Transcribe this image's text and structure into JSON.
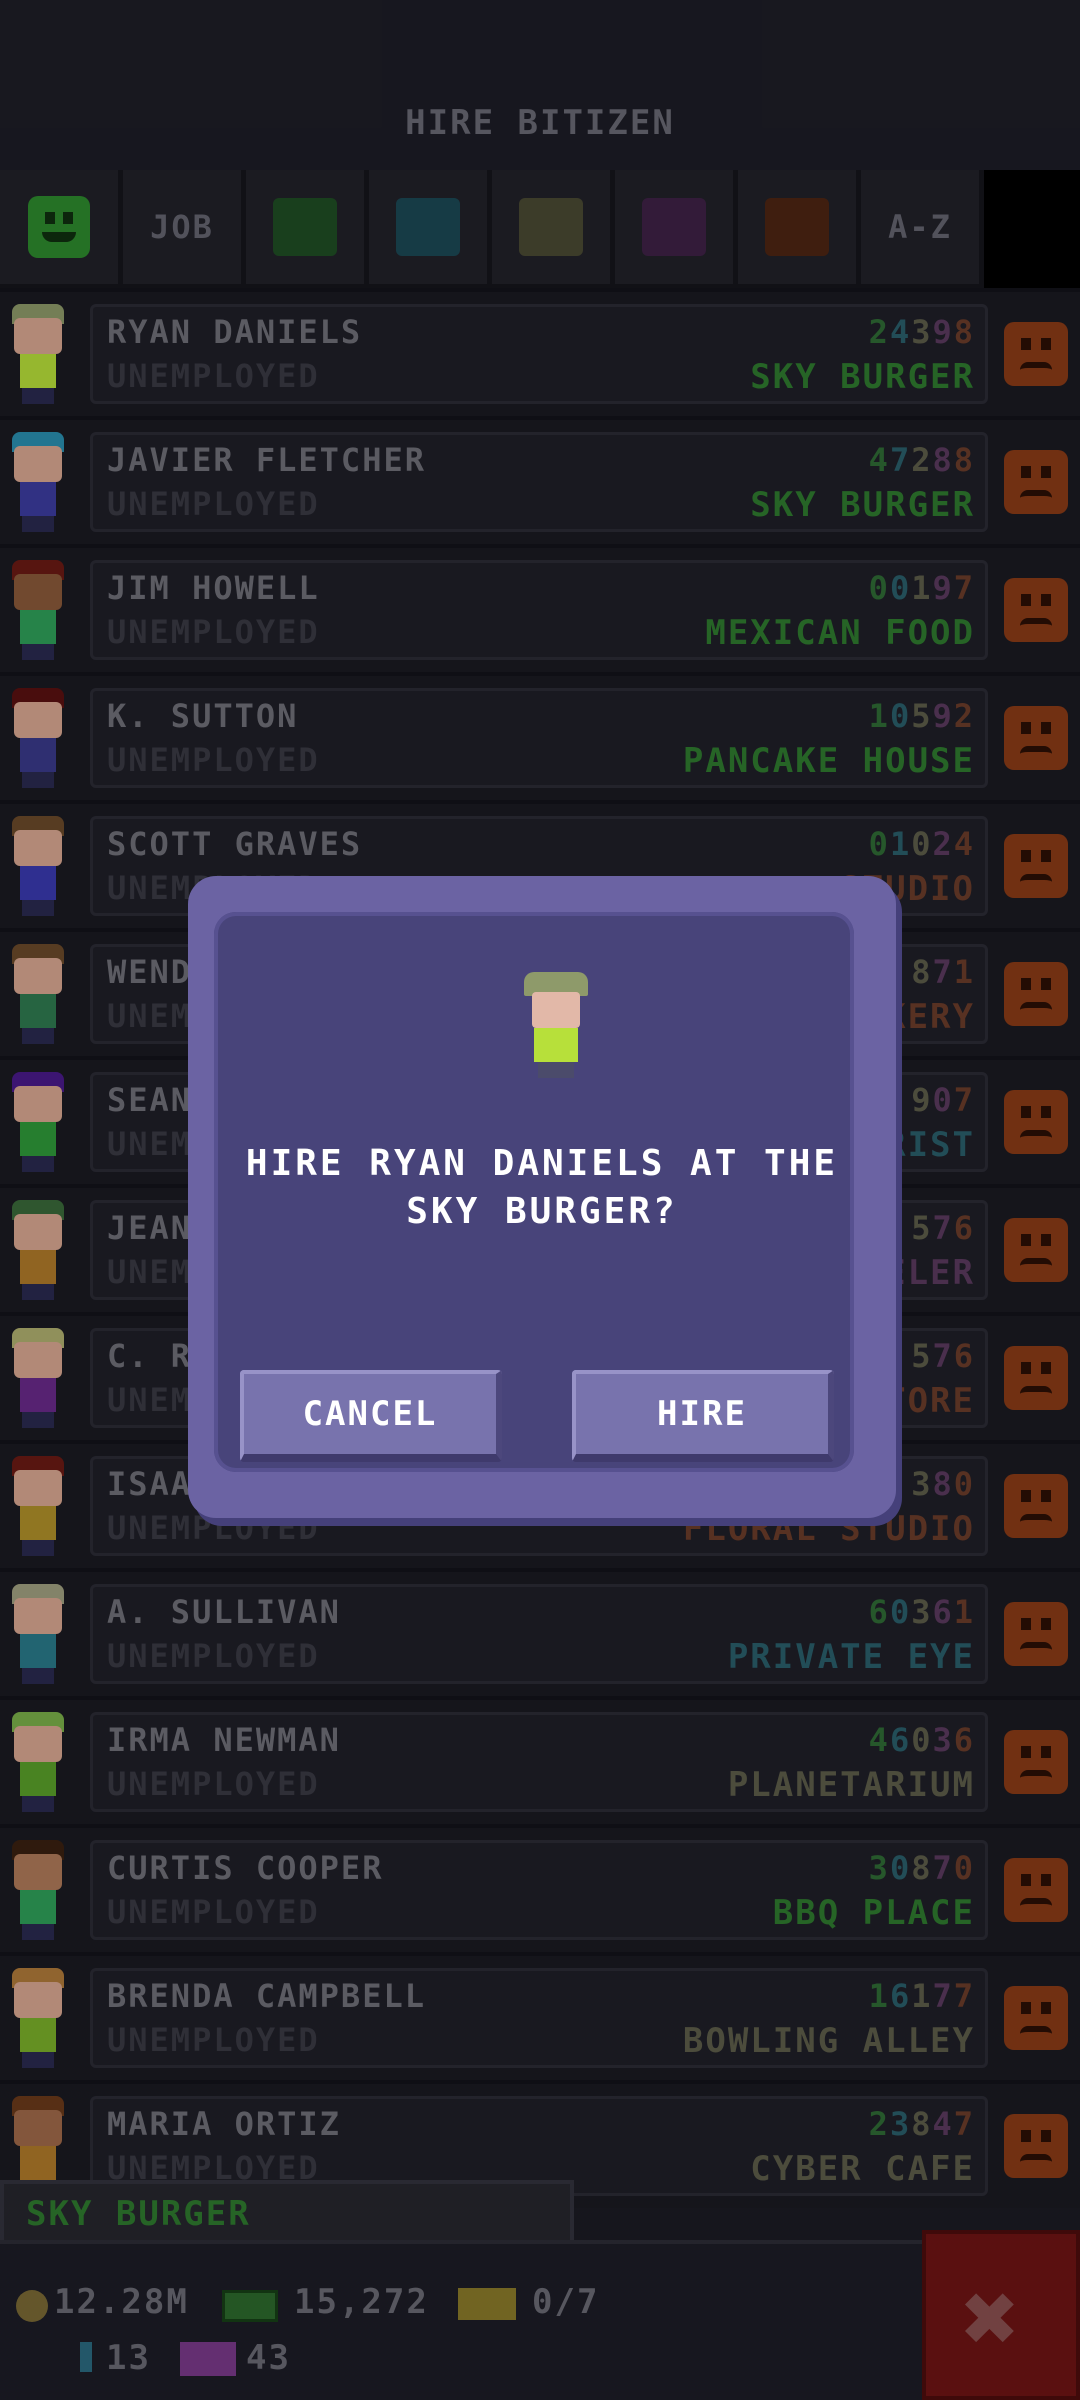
{
  "header": {
    "title": "HIRE BITIZEN"
  },
  "filters": [
    {
      "type": "smiley",
      "name": "happiness-filter"
    },
    {
      "type": "text",
      "label": "JOB"
    },
    {
      "type": "swatch",
      "color": "#1f4d24"
    },
    {
      "type": "swatch",
      "color": "#1c4855"
    },
    {
      "type": "swatch",
      "color": "#4a4a33"
    },
    {
      "type": "swatch",
      "color": "#3f2146"
    },
    {
      "type": "swatch",
      "color": "#4d2513"
    },
    {
      "type": "text",
      "label": "A-Z"
    }
  ],
  "bitizens": [
    {
      "name": "RYAN DANIELS",
      "status": "UNEMPLOYED",
      "stats": [
        "2",
        "4",
        "3",
        "9",
        "8"
      ],
      "dream_job": "SKY BURGER",
      "job_color": "#2f7a2f",
      "hair": "#8e9a6a",
      "skin": "#d9a892",
      "shirt": "#b7e03a"
    },
    {
      "name": "JAVIER FLETCHER",
      "status": "UNEMPLOYED",
      "stats": [
        "4",
        "7",
        "2",
        "8",
        "8"
      ],
      "dream_job": "SKY BURGER",
      "job_color": "#2f7a2f",
      "hair": "#2a8fb0",
      "skin": "#d9a892",
      "shirt": "#3c3ca0"
    },
    {
      "name": "JIM HOWELL",
      "status": "UNEMPLOYED",
      "stats": [
        "0",
        "0",
        "1",
        "9",
        "7"
      ],
      "dream_job": "MEXICAN FOOD",
      "job_color": "#2f7a2f",
      "hair": "#6b1a14",
      "skin": "#8a5a3a",
      "shirt": "#2fa05a"
    },
    {
      "name": "K. SUTTON",
      "status": "UNEMPLOYED",
      "stats": [
        "1",
        "0",
        "5",
        "9",
        "2"
      ],
      "dream_job": "PANCAKE HOUSE",
      "job_color": "#2f7a2f",
      "hair": "#5a1010",
      "skin": "#d9a892",
      "shirt": "#3a3a8a"
    },
    {
      "name": "SCOTT GRAVES",
      "status": "UNEMPLOYED",
      "stats": [
        "0",
        "1",
        "0",
        "2",
        "4"
      ],
      "dream_job": "STUDIO",
      "job_color": "#6b3c2a",
      "hair": "#6b4a2a",
      "skin": "#d9a892",
      "shirt": "#3a3ab0"
    },
    {
      "name": "WENDY",
      "status": "UNEMPLOYED",
      "stats": [
        "",
        "",
        "8",
        "7",
        "1"
      ],
      "dream_job": "BAKERY",
      "job_color": "#6b3c2a",
      "hair": "#6b4a2a",
      "skin": "#d9a892",
      "shirt": "#2f7a50"
    },
    {
      "name": "SEAN",
      "status": "UNEMPLOYED",
      "stats": [
        "",
        "",
        "9",
        "0",
        "7"
      ],
      "dream_job": "FLORIST",
      "job_color": "#2a5f6b",
      "hair": "#4a1a8a",
      "skin": "#d9a892",
      "shirt": "#2f9a3a"
    },
    {
      "name": "JEAN",
      "status": "UNEMPLOYED",
      "stats": [
        "",
        "",
        "5",
        "7",
        "6"
      ],
      "dream_job": "JEWELER",
      "job_color": "#5b3a5e",
      "hair": "#3a6a3a",
      "skin": "#d9a892",
      "shirt": "#b07a2a"
    },
    {
      "name": "C. R",
      "status": "UNEMPLOYED",
      "stats": [
        "",
        "",
        "5",
        "7",
        "6"
      ],
      "dream_job": "STORE",
      "job_color": "#6b3c2a",
      "hair": "#b0b070",
      "skin": "#d9a892",
      "shirt": "#6a2a8a"
    },
    {
      "name": "ISAAC",
      "status": "UNEMPLOYED",
      "stats": [
        "",
        "",
        "3",
        "8",
        "0"
      ],
      "dream_job": "FLORAL STUDIO",
      "job_color": "#6b3c2a",
      "hair": "#6b1a14",
      "skin": "#d9a892",
      "shirt": "#b0902a"
    },
    {
      "name": "A. SULLIVAN",
      "status": "UNEMPLOYED",
      "stats": [
        "6",
        "0",
        "3",
        "6",
        "1"
      ],
      "dream_job": "PRIVATE EYE",
      "job_color": "#2a5f6b",
      "hair": "#a0a080",
      "skin": "#d9a892",
      "shirt": "#2a7a8a"
    },
    {
      "name": "IRMA NEWMAN",
      "status": "UNEMPLOYED",
      "stats": [
        "4",
        "6",
        "0",
        "3",
        "6"
      ],
      "dream_job": "PLANETARIUM",
      "job_color": "#5d5d4a",
      "hair": "#7ab04a",
      "skin": "#d9a892",
      "shirt": "#5aa02a"
    },
    {
      "name": "CURTIS COOPER",
      "status": "UNEMPLOYED",
      "stats": [
        "3",
        "0",
        "8",
        "7",
        "0"
      ],
      "dream_job": "BBQ PLACE",
      "job_color": "#2f7a2f",
      "hair": "#3a2010",
      "skin": "#b07a5a",
      "shirt": "#2fa05a"
    },
    {
      "name": "BRENDA CAMPBELL",
      "status": "UNEMPLOYED",
      "stats": [
        "1",
        "6",
        "1",
        "7",
        "7"
      ],
      "dream_job": "BOWLING ALLEY",
      "job_color": "#5d5d4a",
      "hair": "#b07a3a",
      "skin": "#d9a892",
      "shirt": "#7ab02a"
    },
    {
      "name": "MARIA ORTIZ",
      "status": "UNEMPLOYED",
      "stats": [
        "2",
        "3",
        "8",
        "4",
        "7"
      ],
      "dream_job": "CYBER CAFE",
      "job_color": "#5d5d4a",
      "hair": "#6b3a1a",
      "skin": "#a06a4a",
      "shirt": "#b07a2a"
    }
  ],
  "dialog": {
    "message": "HIRE RYAN DANIELS AT THE SKY BURGER?",
    "cancel_label": "CANCEL",
    "hire_label": "HIRE"
  },
  "bottom": {
    "selected_business": "SKY BURGER",
    "coins": "12.28M",
    "bux": "15,272",
    "vip_count": "0/7",
    "pins": "13",
    "tv_count": "43",
    "close_label": "✖"
  }
}
